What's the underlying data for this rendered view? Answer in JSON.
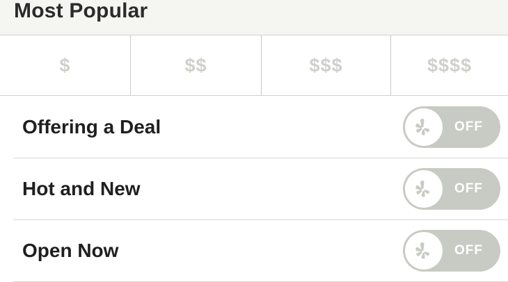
{
  "section": {
    "title": "Most Popular"
  },
  "price_filters": [
    "$",
    "$$",
    "$$$",
    "$$$$"
  ],
  "filters": [
    {
      "label": "Offering a Deal",
      "state": "OFF"
    },
    {
      "label": "Hot and New",
      "state": "OFF"
    },
    {
      "label": "Open Now",
      "state": "OFF"
    }
  ],
  "colors": {
    "header_bg": "#f5f5f2",
    "price_text": "#cfcfcb",
    "toggle_off_bg": "#c8cbc3",
    "toggle_knob": "#ffffff",
    "label_text": "#1f1f1f"
  },
  "icons": {
    "toggle_knob": "yelp-burst-icon"
  }
}
